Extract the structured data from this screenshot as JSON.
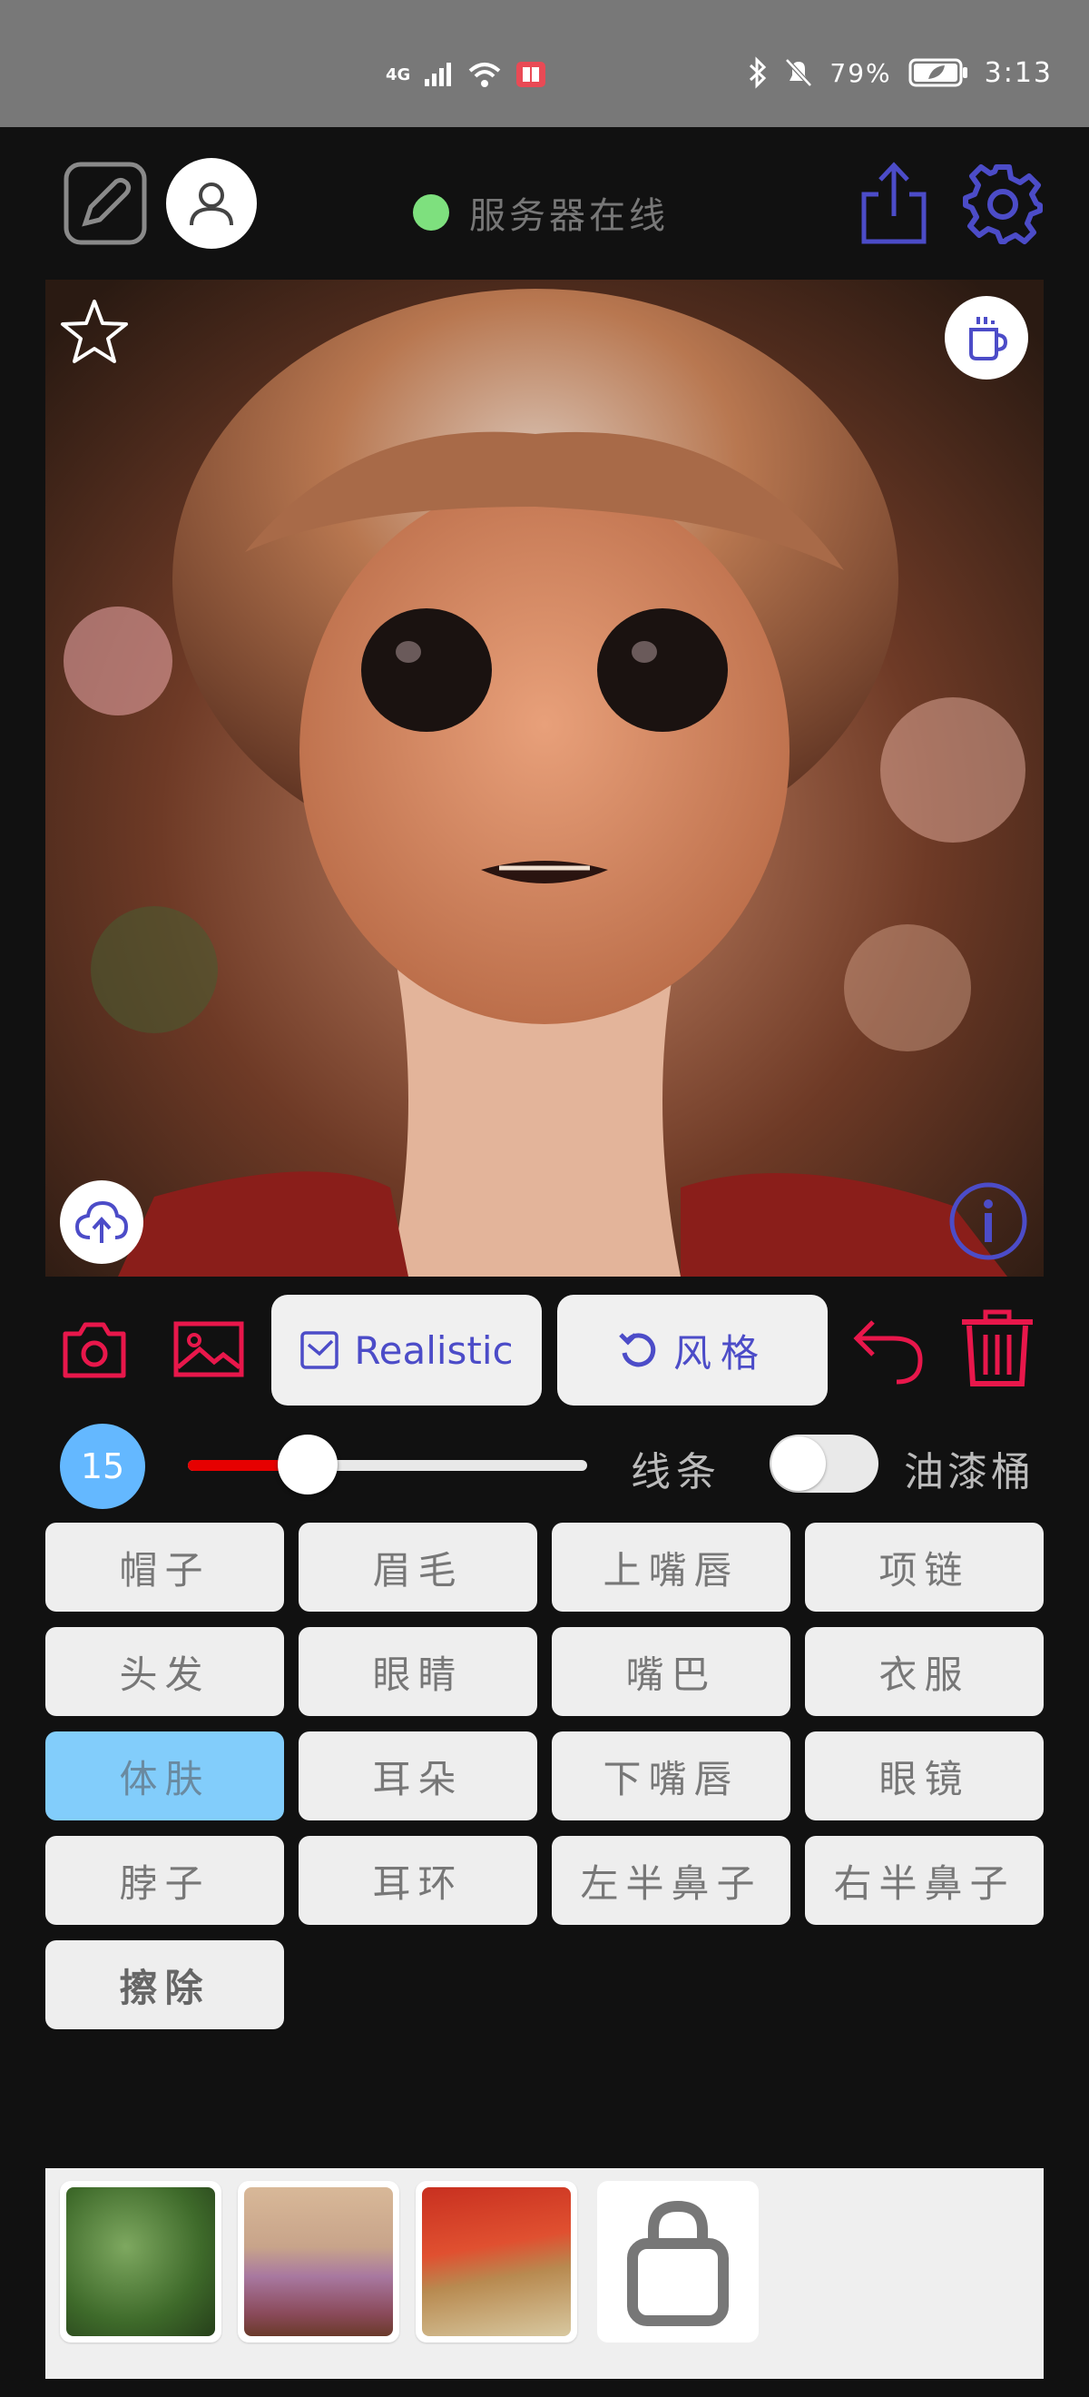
{
  "status_bar": {
    "network": "4G",
    "battery_percent": "79%",
    "time": "3:13"
  },
  "header": {
    "server_status": "服务器在线",
    "server_status_color": "#7ee07e",
    "accent_color": "#4c4cc8"
  },
  "toolbar": {
    "style_mode_label": "Realistic",
    "style_button_label": "风格",
    "danger_color": "#e8174b"
  },
  "brush": {
    "size": "15",
    "slider_value_fraction": 0.3
  },
  "labels": {
    "lines": "线条",
    "paint_bucket": "油漆桶"
  },
  "toggle": {
    "paint_bucket_on": false
  },
  "parts": [
    {
      "label": "帽子",
      "selected": false
    },
    {
      "label": "眉毛",
      "selected": false
    },
    {
      "label": "上嘴唇",
      "selected": false
    },
    {
      "label": "项链",
      "selected": false
    },
    {
      "label": "头发",
      "selected": false
    },
    {
      "label": "眼睛",
      "selected": false
    },
    {
      "label": "嘴巴",
      "selected": false
    },
    {
      "label": "衣服",
      "selected": false
    },
    {
      "label": "体肤",
      "selected": true
    },
    {
      "label": "耳朵",
      "selected": false
    },
    {
      "label": "下嘴唇",
      "selected": false
    },
    {
      "label": "眼镜",
      "selected": false
    },
    {
      "label": "脖子",
      "selected": false
    },
    {
      "label": "耳环",
      "selected": false
    },
    {
      "label": "左半鼻子",
      "selected": false
    },
    {
      "label": "右半鼻子",
      "selected": false
    },
    {
      "label": "擦除",
      "selected": false
    }
  ],
  "tray": {
    "items": [
      "green-foliage-thumbnail",
      "purple-flowers-thumbnail",
      "red-flowers-thumbnail",
      "shop-bag-icon"
    ]
  }
}
